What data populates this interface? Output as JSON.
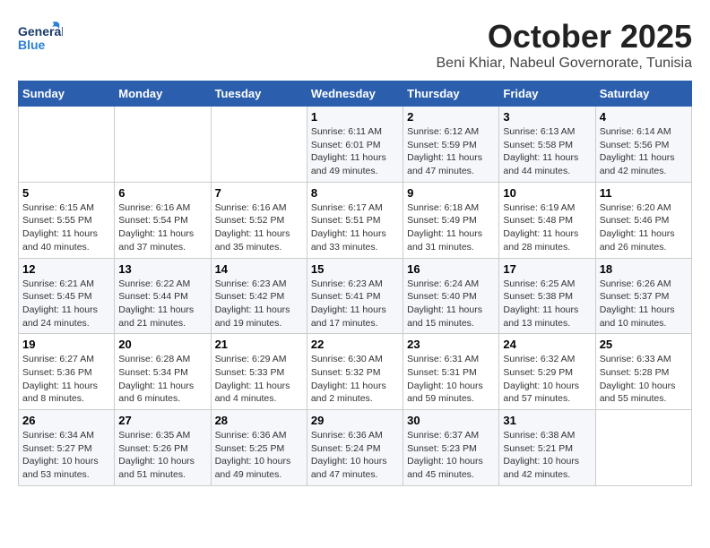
{
  "header": {
    "logo_text_general": "General",
    "logo_text_blue": "Blue",
    "month": "October 2025",
    "location": "Beni Khiar, Nabeul Governorate, Tunisia"
  },
  "days_of_week": [
    "Sunday",
    "Monday",
    "Tuesday",
    "Wednesday",
    "Thursday",
    "Friday",
    "Saturday"
  ],
  "weeks": [
    [
      {
        "num": "",
        "info": ""
      },
      {
        "num": "",
        "info": ""
      },
      {
        "num": "",
        "info": ""
      },
      {
        "num": "1",
        "info": "Sunrise: 6:11 AM\nSunset: 6:01 PM\nDaylight: 11 hours and 49 minutes."
      },
      {
        "num": "2",
        "info": "Sunrise: 6:12 AM\nSunset: 5:59 PM\nDaylight: 11 hours and 47 minutes."
      },
      {
        "num": "3",
        "info": "Sunrise: 6:13 AM\nSunset: 5:58 PM\nDaylight: 11 hours and 44 minutes."
      },
      {
        "num": "4",
        "info": "Sunrise: 6:14 AM\nSunset: 5:56 PM\nDaylight: 11 hours and 42 minutes."
      }
    ],
    [
      {
        "num": "5",
        "info": "Sunrise: 6:15 AM\nSunset: 5:55 PM\nDaylight: 11 hours and 40 minutes."
      },
      {
        "num": "6",
        "info": "Sunrise: 6:16 AM\nSunset: 5:54 PM\nDaylight: 11 hours and 37 minutes."
      },
      {
        "num": "7",
        "info": "Sunrise: 6:16 AM\nSunset: 5:52 PM\nDaylight: 11 hours and 35 minutes."
      },
      {
        "num": "8",
        "info": "Sunrise: 6:17 AM\nSunset: 5:51 PM\nDaylight: 11 hours and 33 minutes."
      },
      {
        "num": "9",
        "info": "Sunrise: 6:18 AM\nSunset: 5:49 PM\nDaylight: 11 hours and 31 minutes."
      },
      {
        "num": "10",
        "info": "Sunrise: 6:19 AM\nSunset: 5:48 PM\nDaylight: 11 hours and 28 minutes."
      },
      {
        "num": "11",
        "info": "Sunrise: 6:20 AM\nSunset: 5:46 PM\nDaylight: 11 hours and 26 minutes."
      }
    ],
    [
      {
        "num": "12",
        "info": "Sunrise: 6:21 AM\nSunset: 5:45 PM\nDaylight: 11 hours and 24 minutes."
      },
      {
        "num": "13",
        "info": "Sunrise: 6:22 AM\nSunset: 5:44 PM\nDaylight: 11 hours and 21 minutes."
      },
      {
        "num": "14",
        "info": "Sunrise: 6:23 AM\nSunset: 5:42 PM\nDaylight: 11 hours and 19 minutes."
      },
      {
        "num": "15",
        "info": "Sunrise: 6:23 AM\nSunset: 5:41 PM\nDaylight: 11 hours and 17 minutes."
      },
      {
        "num": "16",
        "info": "Sunrise: 6:24 AM\nSunset: 5:40 PM\nDaylight: 11 hours and 15 minutes."
      },
      {
        "num": "17",
        "info": "Sunrise: 6:25 AM\nSunset: 5:38 PM\nDaylight: 11 hours and 13 minutes."
      },
      {
        "num": "18",
        "info": "Sunrise: 6:26 AM\nSunset: 5:37 PM\nDaylight: 11 hours and 10 minutes."
      }
    ],
    [
      {
        "num": "19",
        "info": "Sunrise: 6:27 AM\nSunset: 5:36 PM\nDaylight: 11 hours and 8 minutes."
      },
      {
        "num": "20",
        "info": "Sunrise: 6:28 AM\nSunset: 5:34 PM\nDaylight: 11 hours and 6 minutes."
      },
      {
        "num": "21",
        "info": "Sunrise: 6:29 AM\nSunset: 5:33 PM\nDaylight: 11 hours and 4 minutes."
      },
      {
        "num": "22",
        "info": "Sunrise: 6:30 AM\nSunset: 5:32 PM\nDaylight: 11 hours and 2 minutes."
      },
      {
        "num": "23",
        "info": "Sunrise: 6:31 AM\nSunset: 5:31 PM\nDaylight: 10 hours and 59 minutes."
      },
      {
        "num": "24",
        "info": "Sunrise: 6:32 AM\nSunset: 5:29 PM\nDaylight: 10 hours and 57 minutes."
      },
      {
        "num": "25",
        "info": "Sunrise: 6:33 AM\nSunset: 5:28 PM\nDaylight: 10 hours and 55 minutes."
      }
    ],
    [
      {
        "num": "26",
        "info": "Sunrise: 6:34 AM\nSunset: 5:27 PM\nDaylight: 10 hours and 53 minutes."
      },
      {
        "num": "27",
        "info": "Sunrise: 6:35 AM\nSunset: 5:26 PM\nDaylight: 10 hours and 51 minutes."
      },
      {
        "num": "28",
        "info": "Sunrise: 6:36 AM\nSunset: 5:25 PM\nDaylight: 10 hours and 49 minutes."
      },
      {
        "num": "29",
        "info": "Sunrise: 6:36 AM\nSunset: 5:24 PM\nDaylight: 10 hours and 47 minutes."
      },
      {
        "num": "30",
        "info": "Sunrise: 6:37 AM\nSunset: 5:23 PM\nDaylight: 10 hours and 45 minutes."
      },
      {
        "num": "31",
        "info": "Sunrise: 6:38 AM\nSunset: 5:21 PM\nDaylight: 10 hours and 42 minutes."
      },
      {
        "num": "",
        "info": ""
      }
    ]
  ]
}
